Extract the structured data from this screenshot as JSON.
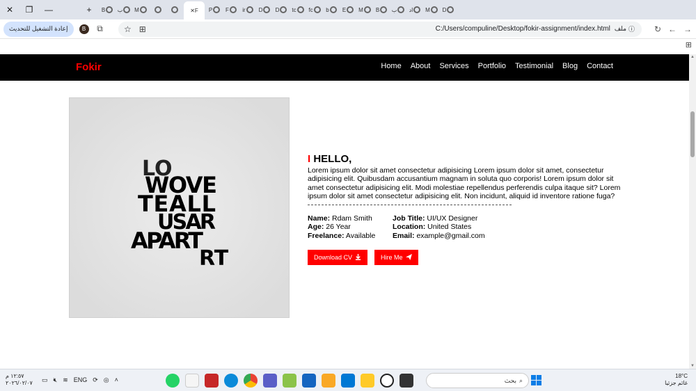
{
  "browser": {
    "tabs": [
      "B",
      "ب",
      "M",
      "P",
      "F",
      "ir",
      "D",
      "D",
      "tc",
      "fc",
      "b",
      "E",
      "M",
      "B",
      "ب",
      "اد",
      "M",
      "D"
    ],
    "active_tab": "F",
    "update_button": "إعادة التشغيل للتحديث",
    "profile_initial": "B",
    "url": "C:/Users/compuline/Desktop/fokir-assignment/index.html",
    "file_chip": "ملف"
  },
  "site": {
    "logo": "Fokir",
    "nav": [
      "Home",
      "About",
      "Services",
      "Portfolio",
      "Testimonial",
      "Blog",
      "Contact"
    ],
    "image_text": [
      "LO",
      "WOVE",
      "TEALL",
      "USAR",
      "APART"
    ],
    "hello_bar": "I",
    "hello": "HELLO,",
    "paragraph": "Lorem ipsum dolor sit amet consectetur adipisicing Lorem ipsum dolor sit amet, consectetur adipisicing elit. Quibusdam accusantium magnam in soluta quo corporis! Lorem ipsum dolor sit amet consectetur adipisicing elit. Modi molestiae repellendus perferendis culpa itaque sit? Lorem ipsum dolor sit amet consectetur adipisicing elit. Non incidunt, aliquid id inventore ratione fuga?",
    "info": {
      "name_label": "Name:",
      "name": "Rdam Smith",
      "age_label": "Age:",
      "age": "26 Year",
      "freelance_label": "Freelance:",
      "freelance": "Available",
      "job_label": "Job Title:",
      "job": "UI/UX Designer",
      "location_label": "Location:",
      "location": "United States",
      "email_label": "Email:",
      "email": "example@gmail.com"
    },
    "download_btn": "Download CV",
    "hire_btn": "Hire Me",
    "accent_color": "#ff0000"
  },
  "taskbar": {
    "time": "١٢:٥٧ م",
    "date": "٢٠٢٦/٠٢/٠٧",
    "lang": "ENG",
    "search_placeholder": "بحث",
    "weather_temp": "18°C",
    "weather_desc": "غائم جزئيا"
  }
}
